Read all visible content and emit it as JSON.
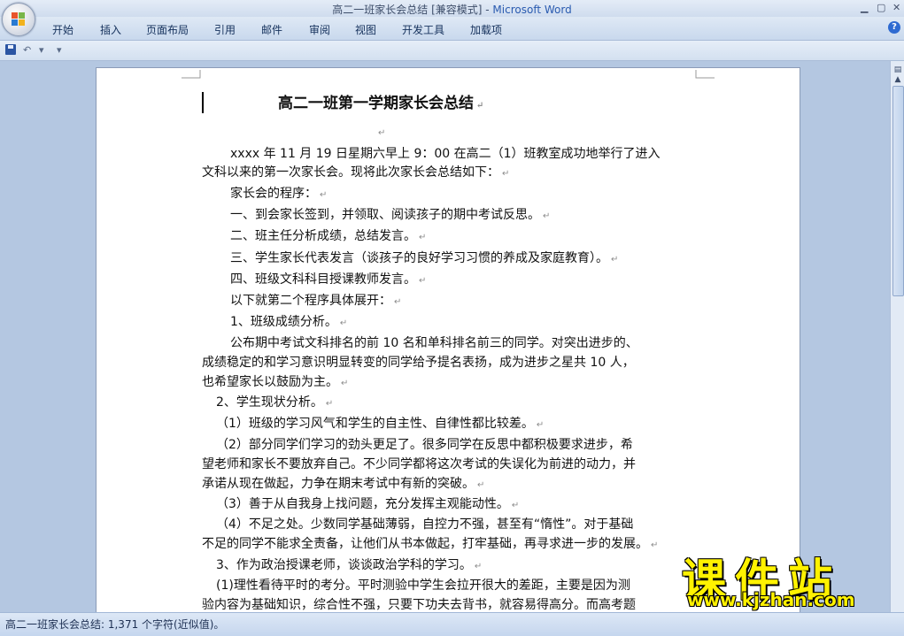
{
  "window": {
    "title_doc": "高二一班家长会总结 [兼容模式] - ",
    "title_app": "Microsoft Word",
    "controls": [
      "▁",
      "▢",
      "✕"
    ]
  },
  "menu": {
    "items": [
      "开始",
      "插入",
      "页面布局",
      "引用",
      "邮件",
      "审阅",
      "视图",
      "开发工具",
      "加载项"
    ],
    "help": "?"
  },
  "qat": {
    "undo": "↶",
    "dropdown": "▾",
    "customize": "▾"
  },
  "document": {
    "title": "高二一班第一学期家长会总结",
    "para_mark": "↵",
    "lines": [
      "xxxx 年 11 月 19 日星期六早上 9：00 在高二（1）班教室成功地举行了进入",
      "文科以来的第一次家长会。现将此次家长会总结如下：",
      "家长会的程序：",
      "一、到会家长签到，并领取、阅读孩子的期中考试反思。",
      "二、班主任分析成绩，总结发言。",
      "三、学生家长代表发言（谈孩子的良好学习习惯的养成及家庭教育）。",
      "四、班级文科科目授课教师发言。",
      "以下就第二个程序具体展开：",
      "1、班级成绩分析。",
      "公布期中考试文科排名的前 10 名和单科排名前三的同学。对突出进步的、",
      "成绩稳定的和学习意识明显转变的同学给予提名表扬，成为进步之星共 10 人，",
      "也希望家长以鼓励为主。",
      "2、学生现状分析。",
      "（1）班级的学习风气和学生的自主性、自律性都比较差。",
      "（2）部分同学们学习的劲头更足了。很多同学在反思中都积极要求进步，希",
      "望老师和家长不要放弃自己。不少同学都将这次考试的失误化为前进的动力，并",
      "承诺从现在做起，力争在期末考试中有新的突破。",
      "（3）善于从自我身上找问题，充分发挥主观能动性。",
      "（4）不足之处。少数同学基础薄弱，自控力不强，甚至有“惰性”。对于基础",
      "不足的同学不能求全责备，让他们从书本做起，打牢基础，再寻求进一步的发展。",
      "3、作为政治授课老师，谈谈政治学科的学习。",
      "(1)理性看待平时的考分。平时测验中学生会拉开很大的差距，主要是因为测",
      "验内容为基础知识，综合性不强，只要下功夫去背书，就容易得高分。而高考题"
    ]
  },
  "status": {
    "text": "高二一班家长会总结: 1,371 个字符(近似值)。"
  },
  "watermark": {
    "cn": "课件站",
    "url": "www.kjzhan.com"
  },
  "scrollbar": {
    "up": "▲",
    "down": "▼"
  }
}
